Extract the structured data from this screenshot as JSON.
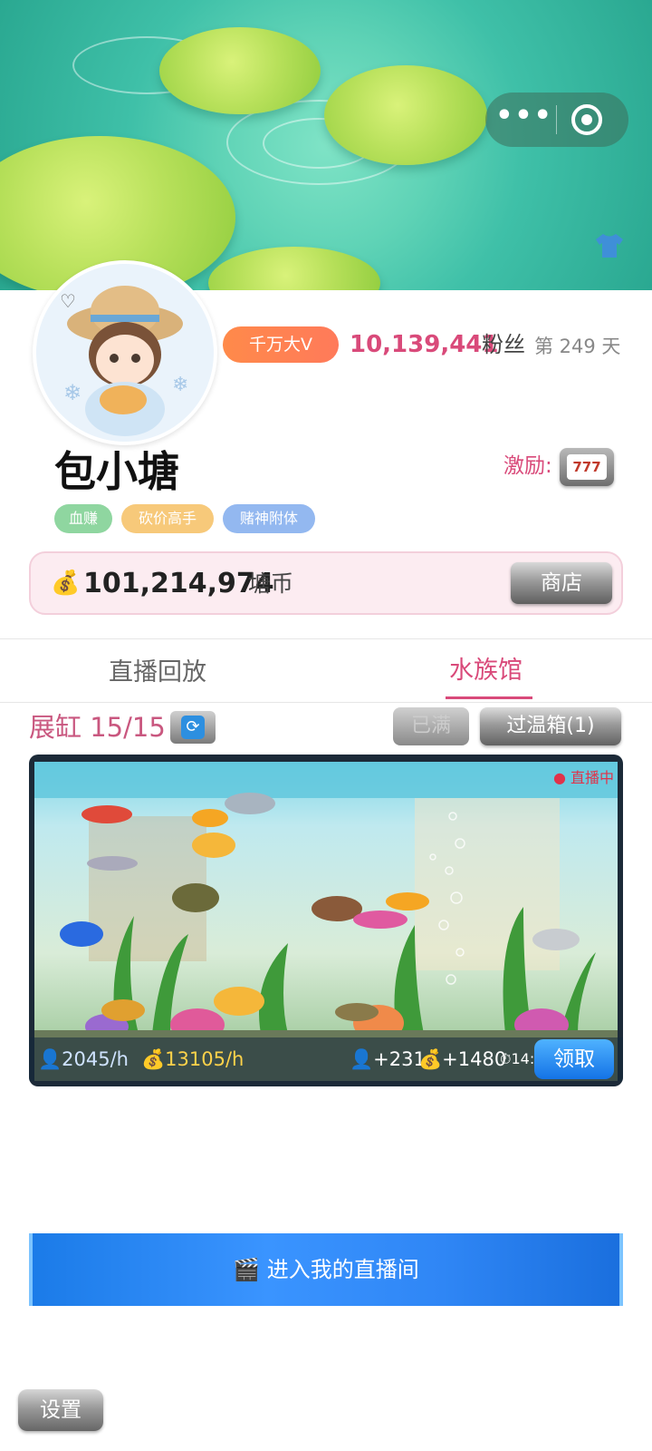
{
  "header": {
    "menu_icon": "more-dots-icon",
    "close_icon": "target-circle-icon",
    "outfit_icon": "shirt-icon"
  },
  "profile": {
    "vip_badge": "千万大V",
    "fans_count": "10,139,441",
    "fans_label": "粉丝",
    "day_text": "第 249 天",
    "name": "包小塘",
    "reward_label": "激励:",
    "reward_icon": "slot-machine-777-icon",
    "tags": [
      "血赚",
      "砍价高手",
      "赌神附体"
    ]
  },
  "wallet": {
    "icon": "money-bag-icon",
    "amount": "101,214,974",
    "unit": "塘币",
    "shop_label": "商店"
  },
  "tabs": [
    {
      "label": "直播回放",
      "active": false
    },
    {
      "label": "水族馆",
      "active": true
    }
  ],
  "aquarium": {
    "tank_label": "展缸 15/15",
    "refresh_icon": "refresh-icon",
    "full_label": "已满",
    "incubator_label": "过温箱(1)",
    "live_tag": "● 直播中",
    "stats": {
      "viewers_rate": "2045/h",
      "coins_rate": "13105/h",
      "viewers_gain": "+231",
      "coins_gain": "+1480",
      "timer": "14:20"
    },
    "claim_label": "领取"
  },
  "live_room_button": "进入我的直播间",
  "settings_label": "设置",
  "colors": {
    "accent": "#d94a7a",
    "vip": "#ff8a4a",
    "claim": "#1f86f0",
    "live_button": "#2f86f5"
  }
}
